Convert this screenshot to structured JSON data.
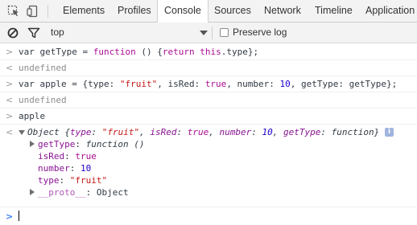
{
  "toolbar": {
    "inspect_icon": "inspect-element-icon",
    "device_icon": "device-toolbar-icon",
    "tabs": [
      "Elements",
      "Profiles",
      "Console",
      "Sources",
      "Network",
      "Timeline",
      "Application"
    ],
    "active_tab": "Console"
  },
  "filterbar": {
    "clear_icon": "clear-console-icon",
    "filter_icon": "filter-icon",
    "context": "top",
    "preserve_log_label": "Preserve log",
    "preserve_log_checked": false
  },
  "console": {
    "cmd1": {
      "p1": "var getType = ",
      "kw1": "function",
      "p2": " () {",
      "kw2": "return",
      "p3": " ",
      "kw3": "this",
      "p4": ".type};"
    },
    "res1": "undefined",
    "cmd2": {
      "p1": "var apple = {type: ",
      "s1": "\"fruit\"",
      "p2": ", isRed: ",
      "k1": "true",
      "p3": ", number: ",
      "n1": "10",
      "p4": ", getType: getType};"
    },
    "res2": "undefined",
    "cmd3": "apple",
    "obj": {
      "summary_label": "Object",
      "summary_open": " {",
      "k_type": "type",
      "v_type": "\"fruit\"",
      "k_isRed": "isRed",
      "v_isRed": "true",
      "k_number": "number",
      "v_number": "10",
      "k_getType": "getType",
      "v_getType": "function",
      "summary_close": "}",
      "info_label": "i",
      "prop_getType_key": "getType",
      "prop_getType_val": "function ()",
      "prop_isRed_key": "isRed",
      "prop_isRed_val": "true",
      "prop_number_key": "number",
      "prop_number_val": "10",
      "prop_type_key": "type",
      "prop_type_val": "\"fruit\"",
      "proto_key": "__proto__",
      "proto_val": "Object"
    },
    "colon": ": ",
    "sep": ", ",
    "prompt_glyph": ">",
    "result_glyph": "<",
    "input_glyph": ">"
  },
  "colors": {
    "prompt_blue": "#367cf1",
    "string_red": "#c41a16",
    "keyword_purple": "#aa0d91",
    "number_blue": "#1c00cf"
  }
}
